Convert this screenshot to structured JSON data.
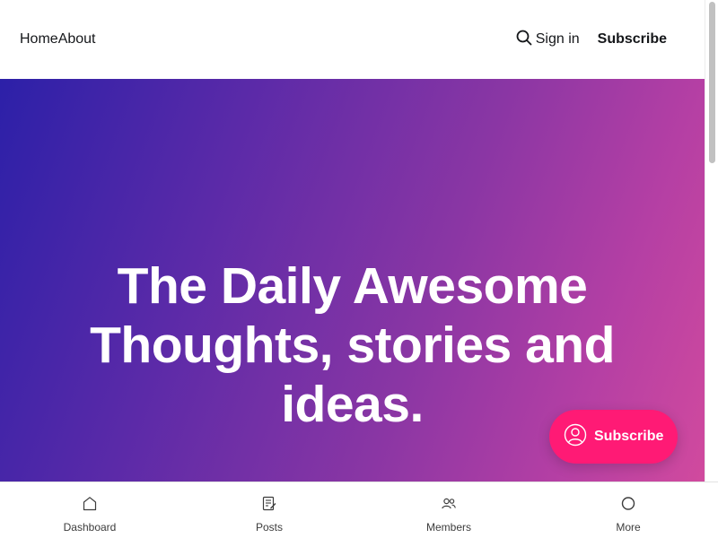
{
  "header": {
    "nav": [
      "Home",
      "About"
    ],
    "signin_label": "Sign in",
    "subscribe_label": "Subscribe"
  },
  "hero": {
    "line1": "The Daily Awesome",
    "line2": "Thoughts, stories and",
    "line3": "ideas.",
    "gradient": [
      "#2c20a8",
      "#8a36a4",
      "#d14a9e"
    ]
  },
  "floating_button": {
    "label": "Subscribe",
    "color": "#ff1a75",
    "icon": "user-circle-icon"
  },
  "tabbar": {
    "tabs": [
      {
        "label": "Dashboard",
        "icon": "home-icon"
      },
      {
        "label": "Posts",
        "icon": "posts-icon"
      },
      {
        "label": "Members",
        "icon": "members-icon"
      },
      {
        "label": "More",
        "icon": "circle-icon"
      }
    ]
  }
}
